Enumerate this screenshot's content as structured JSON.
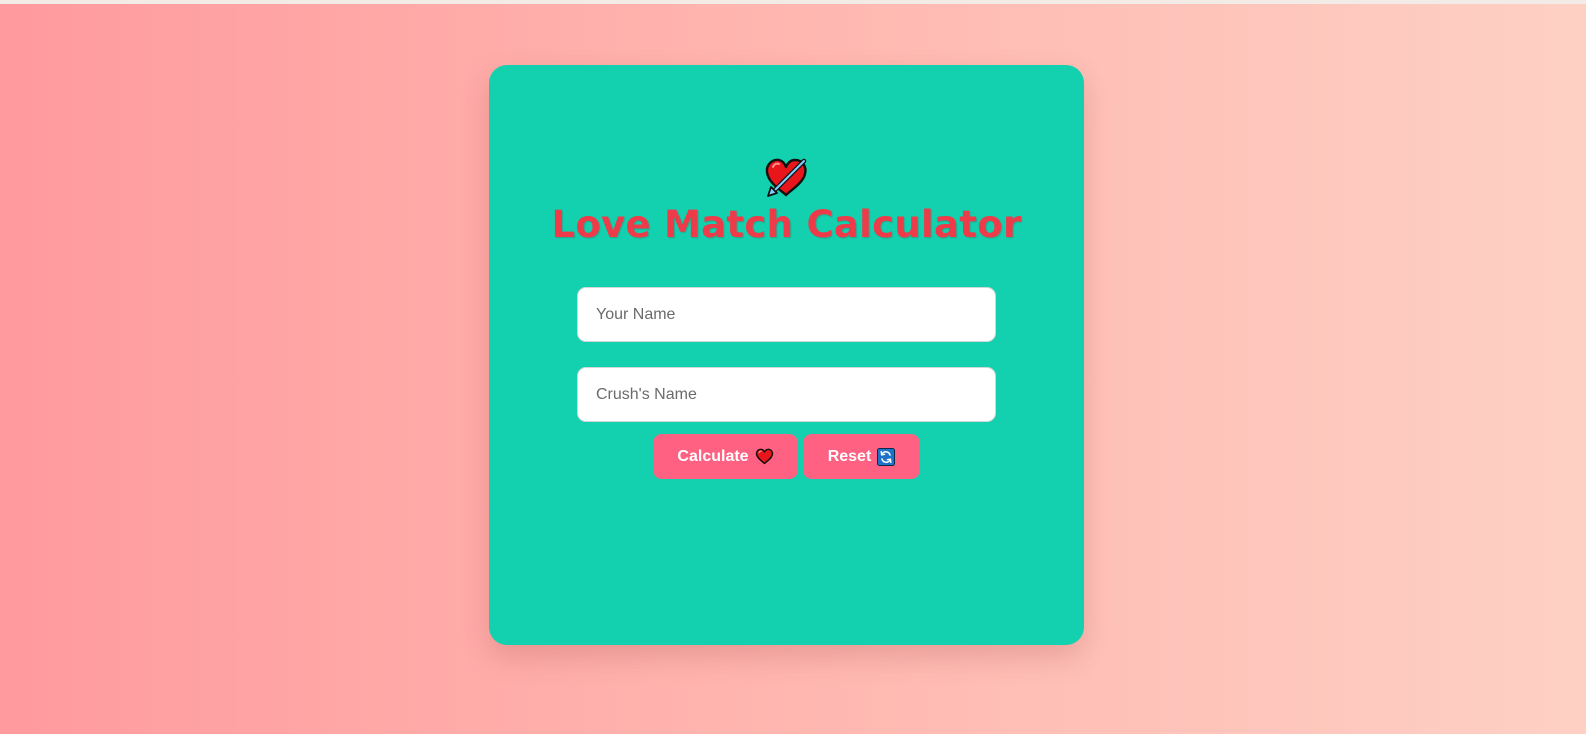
{
  "app": {
    "title": "Love Match Calculator",
    "title_color": "#ee3b4a",
    "card_color": "#13d0ae",
    "accent_button_color": "#ff6183",
    "header_icon": "heart-with-arrow-icon"
  },
  "form": {
    "your_name_placeholder": "Your Name",
    "your_name_value": "",
    "crush_name_placeholder": "Crush's Name",
    "crush_name_value": ""
  },
  "buttons": {
    "calculate_label": "Calculate",
    "calculate_icon": "heart-icon",
    "reset_label": "Reset",
    "reset_icon": "refresh-icon"
  }
}
